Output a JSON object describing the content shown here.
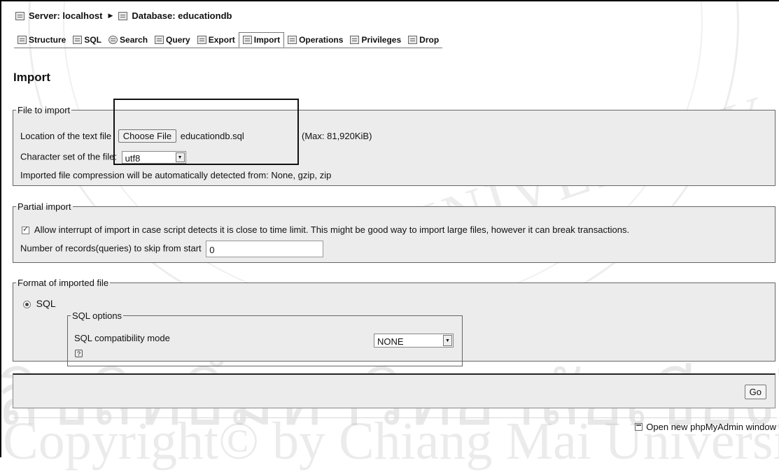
{
  "breadcrumb": {
    "server": "Server: localhost",
    "database": "Database: educationdb"
  },
  "tabs": [
    {
      "label": "Structure",
      "icon": "structure-icon"
    },
    {
      "label": "SQL",
      "icon": "sql-icon"
    },
    {
      "label": "Search",
      "icon": "search-icon"
    },
    {
      "label": "Query",
      "icon": "query-icon"
    },
    {
      "label": "Export",
      "icon": "export-icon"
    },
    {
      "label": "Import",
      "icon": "import-icon",
      "active": true
    },
    {
      "label": "Operations",
      "icon": "operations-icon"
    },
    {
      "label": "Privileges",
      "icon": "privileges-icon"
    },
    {
      "label": "Drop",
      "icon": "drop-icon"
    }
  ],
  "page_title": "Import",
  "file_to_import": {
    "legend": "File to import",
    "location_label": "Location of the text file",
    "choose_file_button": "Choose File",
    "file_name": "educationdb.sql",
    "max_size": "(Max: 81,920KiB)",
    "charset_label": "Character set of the file:",
    "charset_value": "utf8",
    "compression_note": "Imported file compression will be automatically detected from: None, gzip, zip"
  },
  "partial_import": {
    "legend": "Partial import",
    "allow_interrupt_label": "Allow interrupt of import in case script detects it is close to time limit. This might be good way to import large files, however it can break transactions.",
    "allow_interrupt_checked": true,
    "skip_label": "Number of records(queries) to skip from start",
    "skip_value": "0"
  },
  "format": {
    "legend": "Format of imported file",
    "option_sql": "SQL",
    "sql_options_legend": "SQL options",
    "compat_label": "SQL compatibility mode",
    "compat_value": "NONE",
    "help_symbol": "?"
  },
  "go_button": "Go",
  "new_window_link": "Open new phpMyAdmin window",
  "watermark": {
    "line1": "UNIVERSITY",
    "thai": "ลิขสิทธิ์มหาวิทยาลัยเชียงใหม่",
    "copyright": "Copyright© by Chiang Mai University"
  }
}
